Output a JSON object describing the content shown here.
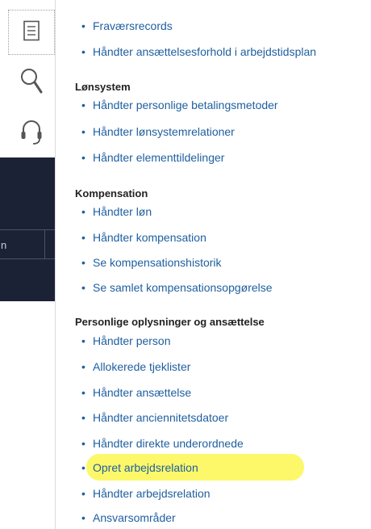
{
  "sidebar": {
    "icons": [
      {
        "name": "document-icon",
        "active": true
      },
      {
        "name": "search-icon",
        "active": false
      },
      {
        "name": "headset-icon",
        "active": false
      }
    ],
    "background_fragment": "n"
  },
  "menu": {
    "top_links": [
      "Fraværsrecords",
      "Håndter ansættelsesforhold i arbejdstidsplan"
    ],
    "sections": [
      {
        "heading": "Lønsystem",
        "links": [
          "Håndter personlige betalingsmetoder",
          "Håndter lønsystemrelationer",
          "Håndter elementtildelinger"
        ]
      },
      {
        "heading": "Kompensation",
        "links": [
          "Håndter løn",
          "Håndter kompensation",
          "Se kompensationshistorik",
          "Se samlet kompensationsopgørelse"
        ]
      },
      {
        "heading": "Personlige oplysninger og ansættelse",
        "links": [
          "Håndter person",
          "Allokerede tjeklister",
          "Håndter ansættelse",
          "Håndter anciennitetsdatoer",
          "Håndter direkte underordnede",
          "Opret arbejdsrelation",
          "Håndter arbejdsrelation",
          "Ansvarsområder"
        ]
      }
    ],
    "highlighted_link": "Opret arbejdsrelation",
    "highlight_color": "#fcf86a",
    "link_color": "#1f5fa0"
  }
}
